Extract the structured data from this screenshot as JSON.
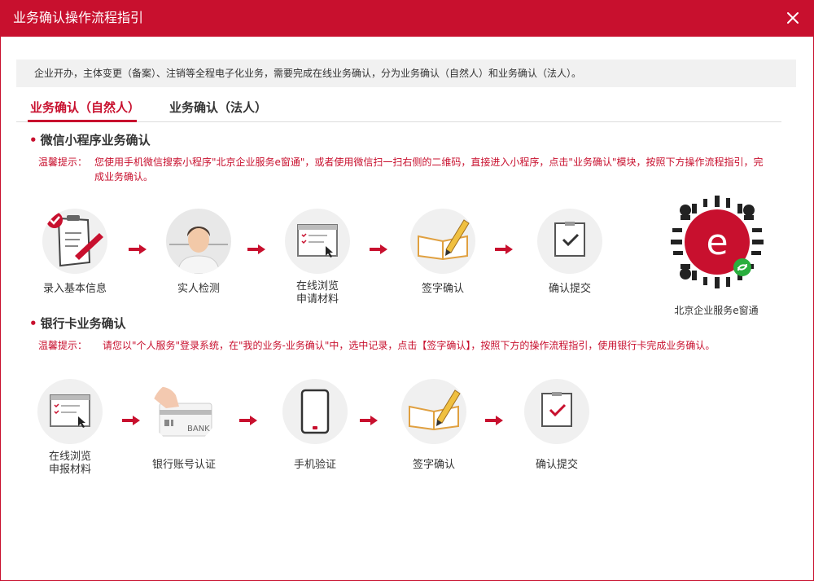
{
  "window": {
    "title": "业务确认操作流程指引"
  },
  "notice": "企业开办，主体变更（备案）、注销等全程电子化业务，需要完成在线业务确认，分为业务确认（自然人）和业务确认（法人）。",
  "tabs": [
    {
      "label": "业务确认（自然人）",
      "active": true
    },
    {
      "label": "业务确认（法人）",
      "active": false
    }
  ],
  "wechat": {
    "title": "微信小程序业务确认",
    "tip_label": "温馨提示：",
    "tip_text": "您使用手机微信搜索小程序\"北京企业服务e窗通\"，或者使用微信扫一扫右侧的二维码，直接进入小程序，点击\"业务确认\"模块，按照下方操作流程指引，完成业务确认。",
    "steps": [
      {
        "label": "录入基本信息",
        "icon": "clipboard-pen-icon"
      },
      {
        "label": "实人检测",
        "icon": "face-person-icon"
      },
      {
        "label": "在线浏览\n申请材料",
        "icon": "document-screen-icon"
      },
      {
        "label": "签字确认",
        "icon": "open-book-pen-icon"
      },
      {
        "label": "确认提交",
        "icon": "check-box-icon"
      }
    ],
    "qr_label": "北京企业服务e窗通",
    "qr_letter": "e"
  },
  "bank": {
    "title": "银行卡业务确认",
    "tip_label": "温馨提示：",
    "tip_text": "请您以\"个人服务\"登录系统，在\"我的业务-业务确认\"中，选中记录，点击【签字确认】，按照下方的操作流程指引，使用银行卡完成业务确认。",
    "steps": [
      {
        "label": "在线浏览\n申报材料",
        "icon": "document-screen-icon"
      },
      {
        "label": "银行账号认证",
        "icon": "bank-card-icon"
      },
      {
        "label": "手机验证",
        "icon": "phone-icon"
      },
      {
        "label": "签字确认",
        "icon": "open-book-pen-icon"
      },
      {
        "label": "确认提交",
        "icon": "check-box-icon"
      }
    ],
    "bank_card_text": "BANK"
  },
  "colors": {
    "accent": "#c8102e",
    "notice_bg": "#f1f1f1",
    "circle_bg": "#f0f0f0"
  }
}
